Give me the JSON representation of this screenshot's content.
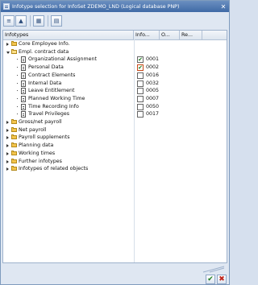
{
  "window": {
    "title": "Infotype selection for InfoSet ZDEMO_LND (Logical database PNP)"
  },
  "toolbar": {
    "buttons": [
      "expand-all-icon",
      "collapse-all-icon",
      "select-all-icon",
      "display-icon"
    ]
  },
  "table": {
    "columns": [
      "Infotypes",
      "Info...",
      "O...",
      "Re..."
    ],
    "rows": [
      {
        "type": "folder",
        "level": 0,
        "expanded": false,
        "label": "Core Employee Info."
      },
      {
        "type": "folder",
        "level": 0,
        "expanded": true,
        "label": "Empl. contract data"
      },
      {
        "type": "item",
        "label": "Organizational Assignment",
        "checked": true,
        "code": "0001"
      },
      {
        "type": "item",
        "label": "Personal Data",
        "checked": true,
        "code": "0002"
      },
      {
        "type": "item",
        "label": "Contract Elements",
        "checked": false,
        "code": "0016"
      },
      {
        "type": "item",
        "label": "Internal Data",
        "checked": false,
        "code": "0032"
      },
      {
        "type": "item",
        "label": "Leave Entitlement",
        "checked": false,
        "code": "0005"
      },
      {
        "type": "item",
        "label": "Planned Working Time",
        "checked": false,
        "code": "0007"
      },
      {
        "type": "item",
        "label": "Time Recording Info",
        "checked": false,
        "code": "0050"
      },
      {
        "type": "item",
        "label": "Travel Privileges",
        "checked": false,
        "code": "0017"
      },
      {
        "type": "folder",
        "level": 0,
        "expanded": false,
        "label": "Gross/net payroll"
      },
      {
        "type": "folder",
        "level": 0,
        "expanded": false,
        "label": "Net payroll"
      },
      {
        "type": "folder",
        "level": 0,
        "expanded": false,
        "label": "Payroll supplements"
      },
      {
        "type": "folder",
        "level": 0,
        "expanded": false,
        "label": "Planning data"
      },
      {
        "type": "folder",
        "level": 0,
        "expanded": false,
        "label": "Working times"
      },
      {
        "type": "folder",
        "level": 0,
        "expanded": false,
        "label": "Further infotypes"
      },
      {
        "type": "folder",
        "level": 0,
        "expanded": false,
        "label": "Infotypes of related objects"
      }
    ]
  },
  "buttons": {
    "ok": "✔",
    "cancel": "✖"
  },
  "colors": {
    "title_bar": "#3f6aa6",
    "check": "#1a7a1a",
    "cancel": "#c0241a"
  }
}
